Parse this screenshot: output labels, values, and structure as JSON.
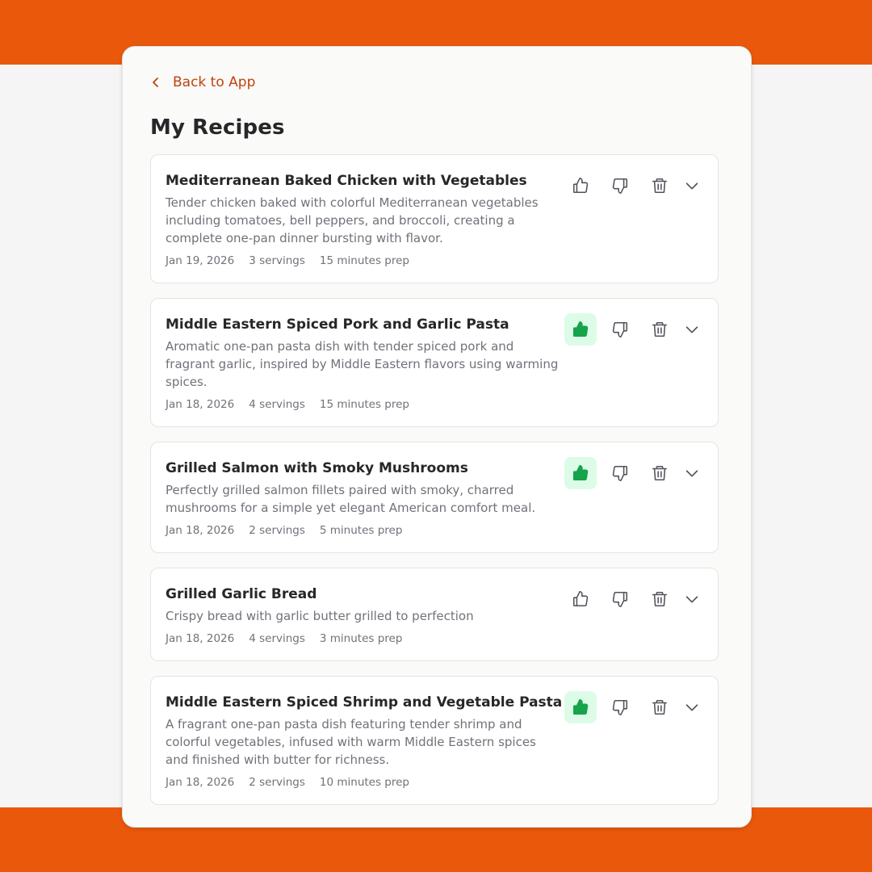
{
  "header": {
    "back_label": "Back to App",
    "title": "My Recipes"
  },
  "colors": {
    "accent": "#ea580c",
    "link": "#c2410c",
    "liked_bg": "#dcfce7",
    "liked_icon": "#16a34a"
  },
  "recipes": [
    {
      "title": "Mediterranean Baked Chicken with Vegetables",
      "description": "Tender chicken baked with colorful Mediterranean vegetables including tomatoes, bell peppers, and broccoli, creating a complete one-pan dinner bursting with flavor.",
      "date": "Jan 19, 2026",
      "servings": "3 servings",
      "prep": "15 minutes prep",
      "liked": false
    },
    {
      "title": "Middle Eastern Spiced Pork and Garlic Pasta",
      "description": "Aromatic one-pan pasta dish with tender spiced pork and fragrant garlic, inspired by Middle Eastern flavors using warming spices.",
      "date": "Jan 18, 2026",
      "servings": "4 servings",
      "prep": "15 minutes prep",
      "liked": true
    },
    {
      "title": "Grilled Salmon with Smoky Mushrooms",
      "description": "Perfectly grilled salmon fillets paired with smoky, charred mushrooms for a simple yet elegant American comfort meal.",
      "date": "Jan 18, 2026",
      "servings": "2 servings",
      "prep": "5 minutes prep",
      "liked": true
    },
    {
      "title": "Grilled Garlic Bread",
      "description": "Crispy bread with garlic butter grilled to perfection",
      "date": "Jan 18, 2026",
      "servings": "4 servings",
      "prep": "3 minutes prep",
      "liked": false
    },
    {
      "title": "Middle Eastern Spiced Shrimp and Vegetable Pasta",
      "description": "A fragrant one-pan pasta dish featuring tender shrimp and colorful vegetables, infused with warm Middle Eastern spices and finished with butter for richness.",
      "date": "Jan 18, 2026",
      "servings": "2 servings",
      "prep": "10 minutes prep",
      "liked": true
    }
  ]
}
